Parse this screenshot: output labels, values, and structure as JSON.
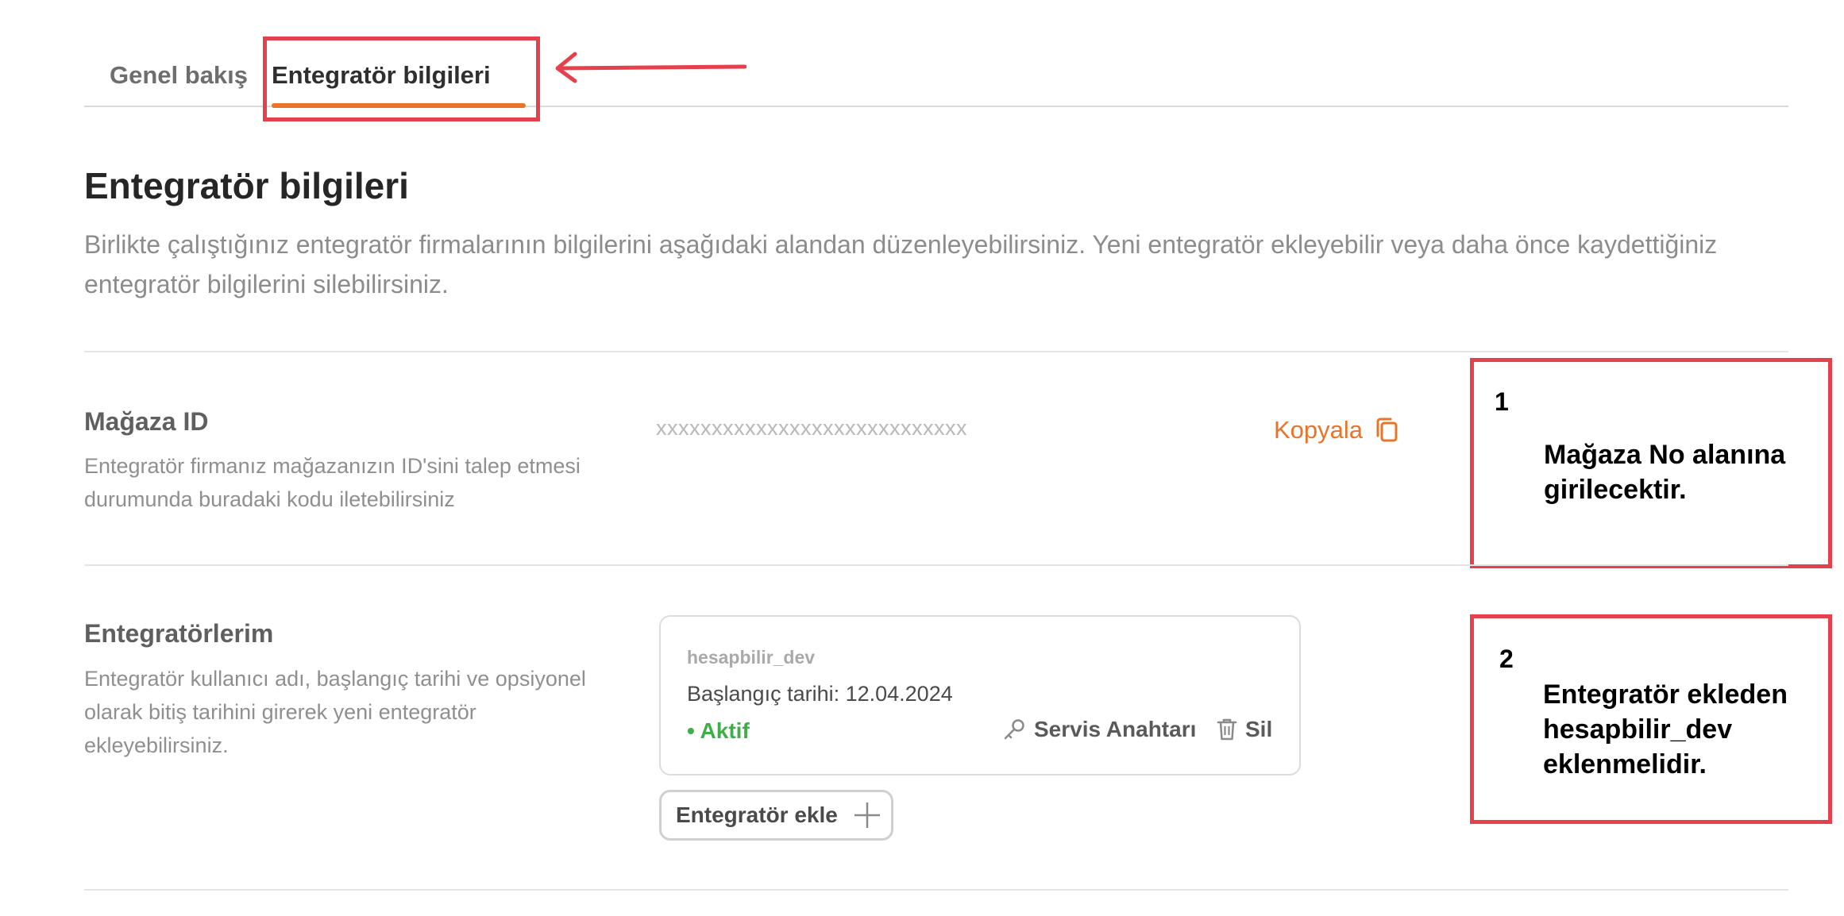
{
  "tabs": [
    {
      "label": "Genel bakış",
      "active": false
    },
    {
      "label": "Entegratör bilgileri",
      "active": true
    }
  ],
  "page": {
    "title": "Entegratör bilgileri",
    "description": "Birlikte çalıştığınız entegratör firmalarının bilgilerini aşağıdaki alandan düzenleyebilirsiniz. Yeni entegratör ekleyebilir veya daha önce kaydettiğiniz entegratör bilgilerini silebilirsiniz."
  },
  "store_section": {
    "title": "Mağaza ID",
    "description": "Entegratör firmanız mağazanızın ID'sini talep etmesi durumunda buradaki kodu iletebilirsiniz",
    "store_id": "xxxxxxxxxxxxxxxxxxxxxxxxxxxx",
    "copy_label": "Kopyala",
    "copy_icon": "copy-icon"
  },
  "integrators_section": {
    "title": "Entegratörlerim",
    "description": "Entegratör kullanıcı adı, başlangıç tarihi ve opsiyonel olarak bitiş tarihini girerek yeni entegratör ekleyebilirsiniz.",
    "card": {
      "username": "hesapbilir_dev",
      "start_date": "Başlangıç tarihi: 12.04.2024",
      "status": "• Aktif",
      "service_key_label": "Servis Anahtarı",
      "delete_label": "Sil",
      "key_icon": "key-icon",
      "delete_icon": "trash-icon"
    },
    "add_button_label": "Entegratör ekle",
    "add_icon": "plus-icon"
  },
  "annotations": {
    "note1": {
      "number": "1",
      "line1": "Mağaza No alanına",
      "line2": "girilecektir."
    },
    "note2": {
      "number": "2",
      "line1": "Entegratör ekleden",
      "line2": "hesapbilir_dev",
      "line3": "eklenmelidir."
    }
  },
  "colors": {
    "accent": "#e8742a",
    "annotation_red": "#e5414c",
    "active_green": "#3fae49"
  }
}
